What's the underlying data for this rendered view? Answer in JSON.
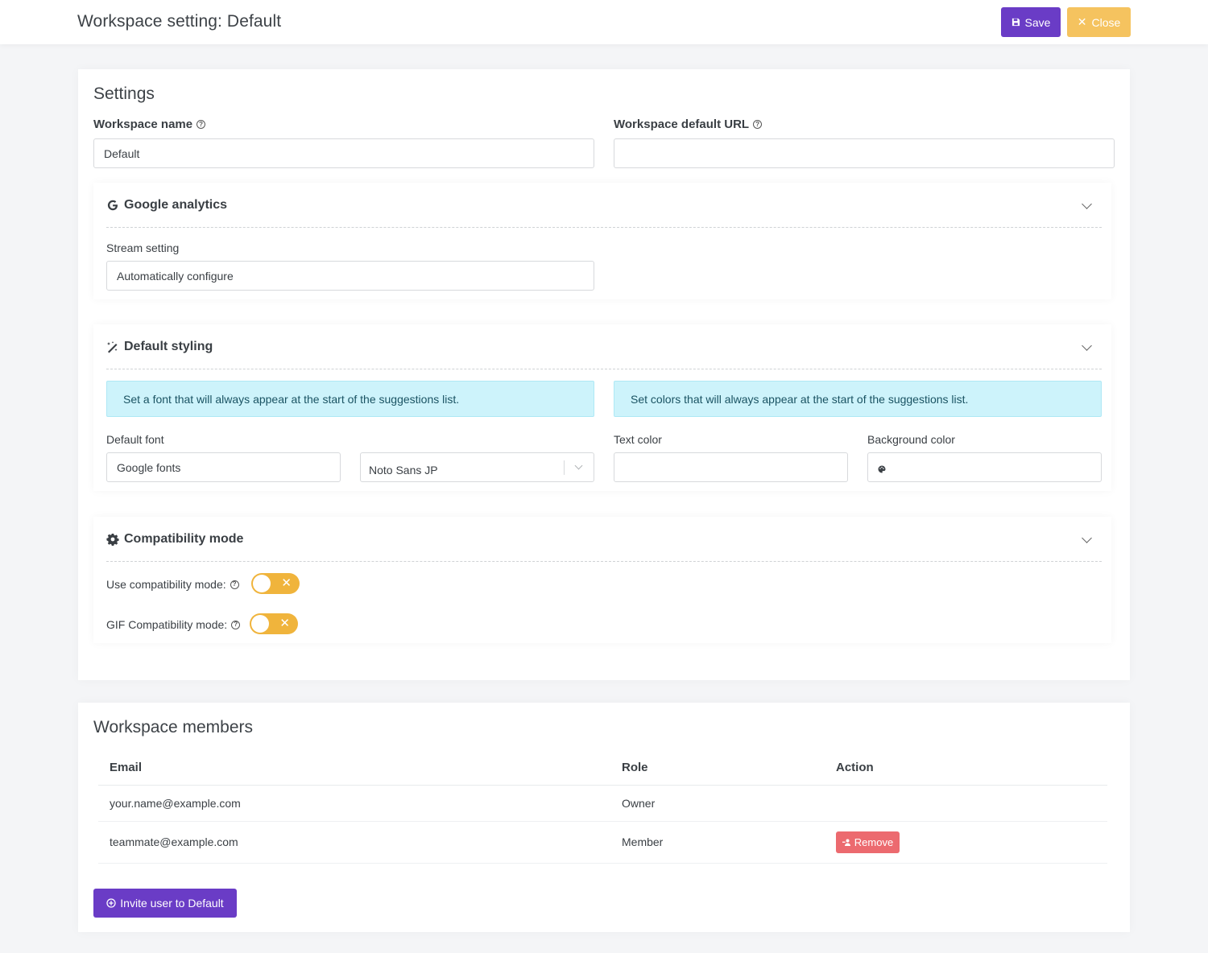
{
  "header": {
    "title": "Workspace setting: Default",
    "save_label": "Save",
    "close_label": "Close",
    "icons": {
      "save": "floppy-disk-icon",
      "close": "close-icon"
    },
    "colors": {
      "save": "#6a3cc6",
      "close": "#f5c35f"
    }
  },
  "settings": {
    "title": "Settings",
    "workspace_name_label": "Workspace name",
    "workspace_name_value": "Default",
    "default_url_label": "Workspace default URL",
    "default_url_value": "",
    "google_analytics": {
      "title": "Google analytics",
      "icon": "google-icon",
      "stream_label": "Stream setting",
      "stream_value": "Automatically configure"
    },
    "default_styling": {
      "title": "Default styling",
      "icon": "magic-wand-icon",
      "font_info": "Set a font that will always appear at the start of the suggestions list.",
      "color_info": "Set colors that will always appear at the start of the suggestions list.",
      "default_font_label": "Default font",
      "font_source_value": "Google fonts",
      "font_select_value": "Noto Sans JP",
      "text_color_label": "Text color",
      "text_color_value": "",
      "background_color_label": "Background color",
      "background_color_value": ""
    },
    "compatibility": {
      "title": "Compatibility mode",
      "icon": "gear-icon",
      "use_label": "Use compatibility mode:",
      "use_enabled": false,
      "gif_label": "GIF Compatibility mode:",
      "gif_enabled": false
    }
  },
  "members": {
    "title": "Workspace members",
    "columns": [
      "Email",
      "Role",
      "Action"
    ],
    "rows": [
      {
        "email": "your.name@example.com",
        "role": "Owner",
        "action": ""
      },
      {
        "email": "teammate@example.com",
        "role": "Member",
        "action": "Remove"
      }
    ],
    "invite_label": "Invite user to Default"
  }
}
